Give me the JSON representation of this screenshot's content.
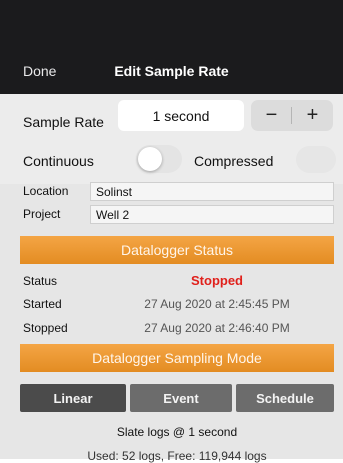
{
  "nav": {
    "done_label": "Done",
    "title": "Edit Sample Rate"
  },
  "sample_rate": {
    "label": "Sample Rate",
    "value": "1 second",
    "minus": "−",
    "plus": "+"
  },
  "mode_toggle": {
    "left_label": "Continuous",
    "right_label": "Compressed",
    "compressed_on": false
  },
  "info": {
    "location_label": "Location",
    "location_value": "Solinst",
    "project_label": "Project",
    "project_value": "Well 2"
  },
  "status_section": {
    "title": "Datalogger Status",
    "rows": [
      {
        "label": "Status",
        "value": "Stopped"
      },
      {
        "label": "Started",
        "value": "27 Aug 2020 at 2:45:45 PM"
      },
      {
        "label": "Stopped",
        "value": "27 Aug 2020 at 2:46:40 PM"
      }
    ]
  },
  "sampling_section": {
    "title": "Datalogger Sampling Mode",
    "buttons": [
      "Linear",
      "Event",
      "Schedule"
    ],
    "active": "Linear",
    "summary": "Slate logs @ 1 second",
    "summary2": "Used: 52 logs, Free: 119,944 logs"
  },
  "colors": {
    "accent_orange": "#e8922a",
    "status_red": "#e0201b",
    "bar_dark": "#1b1b1d"
  }
}
